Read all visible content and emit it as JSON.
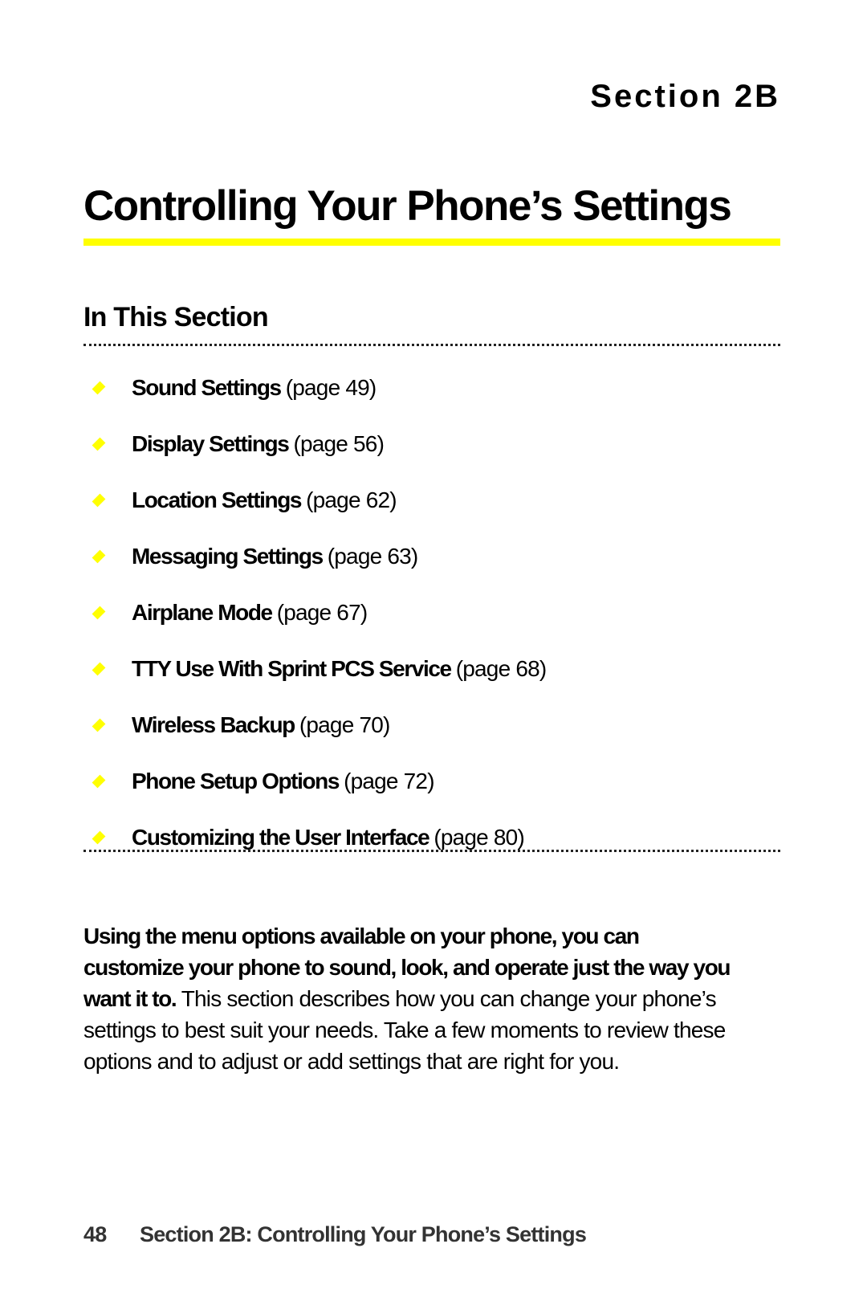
{
  "header": {
    "section_label": "Section 2B",
    "title": "Controlling Your Phone’s Settings",
    "accent_color": "#ffff00"
  },
  "toc": {
    "heading": "In This Section",
    "items": [
      {
        "title": "Sound Settings",
        "page": "(page 49)"
      },
      {
        "title": "Display Settings",
        "page": "(page 56)"
      },
      {
        "title": "Location Settings",
        "page": "(page 62)"
      },
      {
        "title": "Messaging Settings",
        "page": "(page 63)"
      },
      {
        "title": "Airplane Mode",
        "page": "(page 67)"
      },
      {
        "title": "TTY Use With Sprint PCS Service",
        "page": "(page 68)"
      },
      {
        "title": "Wireless Backup",
        "page": "(page 70)"
      },
      {
        "title": "Phone Setup Options",
        "page": "(page 72)"
      },
      {
        "title": "Customizing the User Interface",
        "page": "(page 80)"
      }
    ]
  },
  "intro": {
    "bold": "Using the menu options available on your phone, you can customize your phone to sound, look, and operate just the way you want it to.",
    "text": " This section describes how you can change your phone’s settings to best suit your needs. Take a few moments to review these options and to adjust or add settings that are right for you."
  },
  "footer": {
    "page_number": "48",
    "running_title": "Section 2B: Controlling Your Phone’s Settings"
  }
}
